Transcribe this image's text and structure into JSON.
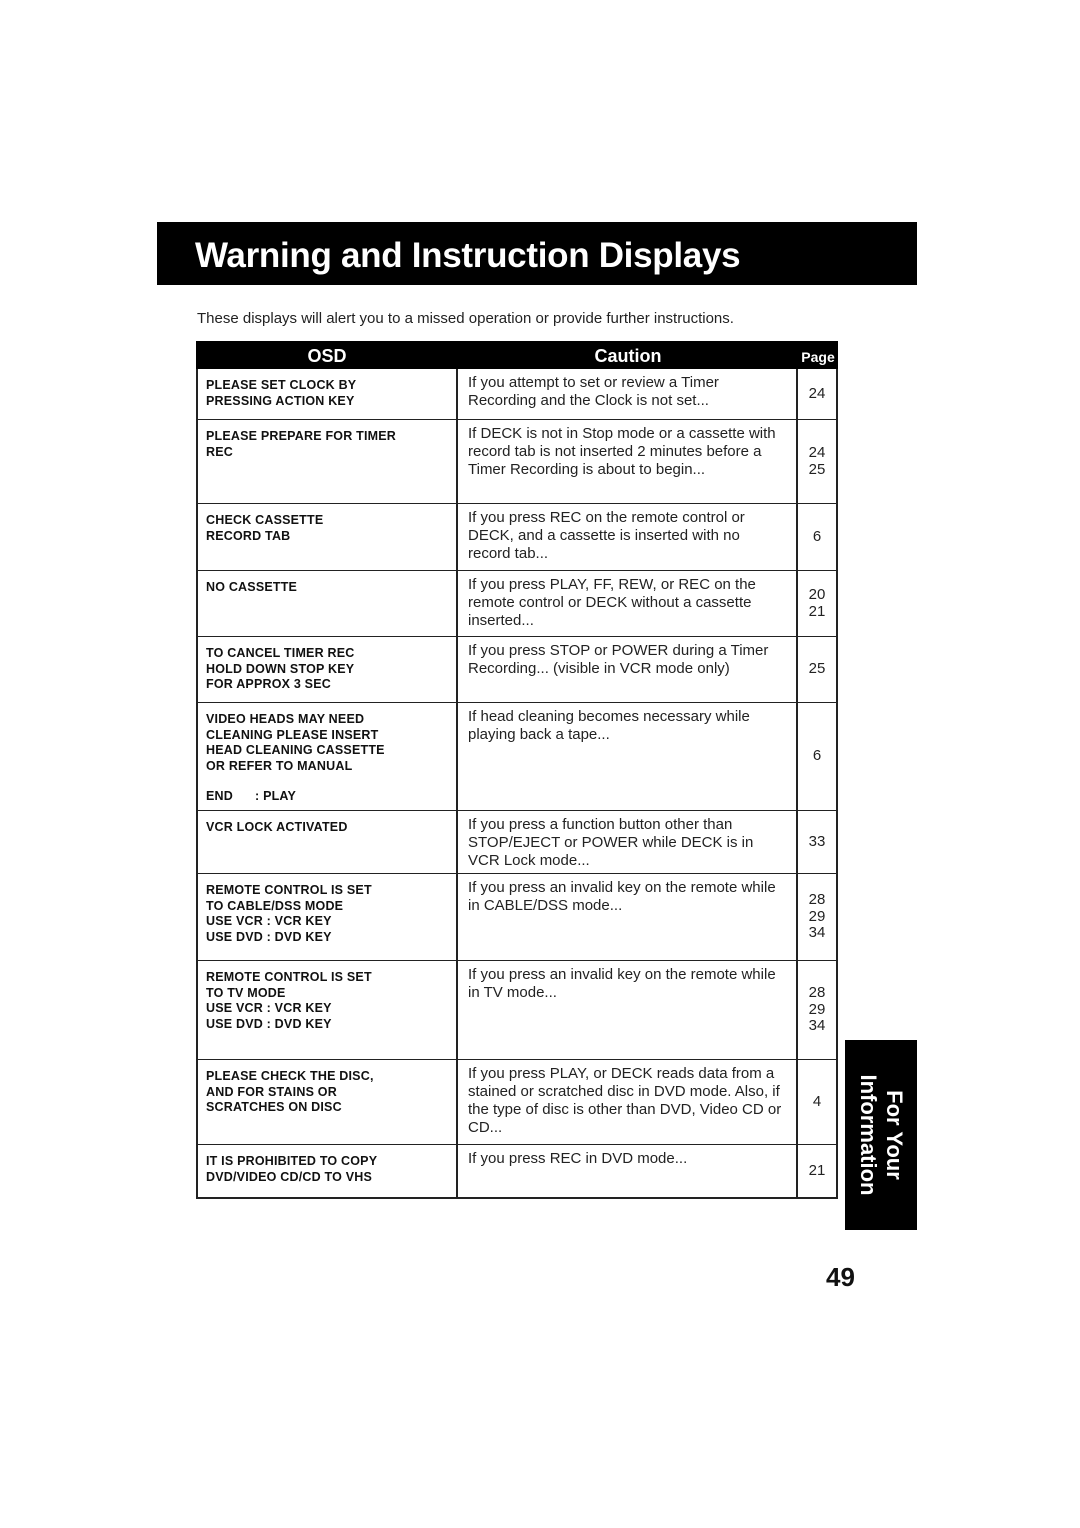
{
  "title": "Warning and Instruction Displays",
  "intro": "These displays will alert you to a missed operation or provide further instructions.",
  "table": {
    "headers": {
      "osd": "OSD",
      "caution": "Caution",
      "page": "Page"
    },
    "rows": [
      {
        "osd": [
          "PLEASE SET CLOCK BY",
          "PRESSING ACTION KEY"
        ],
        "caution": "If you attempt to set or review a Timer Recording and the Clock is not set...",
        "pages": [
          "24"
        ]
      },
      {
        "osd": [
          "PLEASE PREPARE FOR TIMER",
          "REC"
        ],
        "caution": "If DECK is not in Stop mode or a cassette with record tab is not inserted 2 minutes before a Timer Recording is about to begin...",
        "pages": [
          "24",
          "25"
        ]
      },
      {
        "osd": [
          "CHECK CASSETTE",
          "RECORD TAB"
        ],
        "caution": "If you press REC on the remote control or DECK, and a cassette is inserted with no record tab...",
        "pages": [
          "6"
        ]
      },
      {
        "osd": [
          "NO CASSETTE"
        ],
        "caution": "If you press PLAY, FF, REW, or REC on the remote control or DECK without a cassette inserted...",
        "pages": [
          "20",
          "21"
        ]
      },
      {
        "osd": [
          "TO CANCEL TIMER REC",
          "HOLD DOWN STOP KEY",
          "FOR APPROX 3 SEC"
        ],
        "caution": "If you press STOP or POWER during a Timer Recording... (visible in VCR mode only)",
        "pages": [
          "25"
        ]
      },
      {
        "osd": [
          "VIDEO HEADS MAY NEED",
          "CLEANING PLEASE INSERT",
          "HEAD CLEANING CASSETTE",
          "OR REFER TO MANUAL",
          "",
          "END      : PLAY"
        ],
        "caution": "If head cleaning becomes necessary while playing back a tape...",
        "pages": [
          "6"
        ]
      },
      {
        "osd": [
          "VCR LOCK ACTIVATED"
        ],
        "caution": "If you press a function button other than STOP/EJECT or POWER while DECK is in VCR Lock mode...",
        "pages": [
          "33"
        ]
      },
      {
        "osd": [
          "REMOTE CONTROL IS SET",
          "TO CABLE/DSS MODE",
          "USE VCR : VCR KEY",
          "USE DVD : DVD KEY"
        ],
        "caution": "If you press an invalid key on the remote while in CABLE/DSS mode...",
        "pages": [
          "28",
          "29",
          "34"
        ]
      },
      {
        "osd": [
          "REMOTE CONTROL IS SET",
          "TO TV MODE",
          "USE VCR : VCR KEY",
          "USE DVD : DVD KEY"
        ],
        "caution": "If you press an invalid key on the remote while in TV mode...",
        "pages": [
          "28",
          "29",
          "34"
        ]
      },
      {
        "osd": [
          "PLEASE CHECK THE DISC,",
          "AND FOR STAINS OR",
          "SCRATCHES ON DISC"
        ],
        "caution": "If you press PLAY, or DECK reads data from a stained or scratched disc in DVD mode. Also, if the type of disc is other than DVD, Video CD or CD...",
        "pages": [
          "4"
        ]
      },
      {
        "osd": [
          "IT IS PROHIBITED TO COPY",
          "DVD/VIDEO CD/CD TO VHS"
        ],
        "caution": "If you press REC in DVD mode...",
        "pages": [
          "21"
        ]
      }
    ]
  },
  "side_tab": {
    "line1": "For Your",
    "line2": "Information"
  },
  "page_number": "49"
}
